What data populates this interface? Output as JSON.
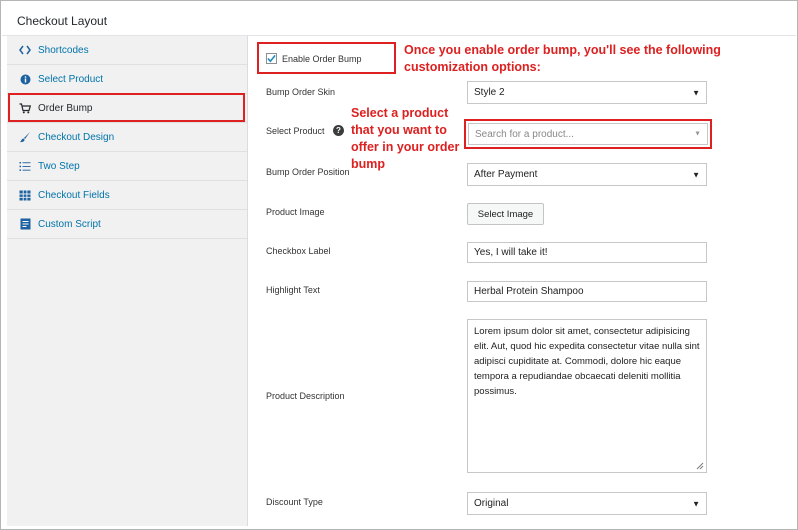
{
  "header": {
    "title": "Checkout Layout"
  },
  "sidebar": {
    "items": [
      {
        "label": "Shortcodes",
        "icon": "code-icon"
      },
      {
        "label": "Select Product",
        "icon": "info-icon"
      },
      {
        "label": "Order Bump",
        "icon": "cart-icon"
      },
      {
        "label": "Checkout Design",
        "icon": "brush-icon"
      },
      {
        "label": "Two Step",
        "icon": "list-icon"
      },
      {
        "label": "Checkout Fields",
        "icon": "table-icon"
      },
      {
        "label": "Custom Script",
        "icon": "document-icon"
      }
    ]
  },
  "form": {
    "enable_label": "Enable Order Bump",
    "enable_checked": true,
    "skin_label": "Bump Order Skin",
    "skin_value": "Style 2",
    "product_label": "Select Product",
    "product_placeholder": "Search for a product...",
    "position_label": "Bump Order Position",
    "position_value": "After Payment",
    "image_label": "Product Image",
    "image_button": "Select Image",
    "checkbox_label": "Checkbox Label",
    "checkbox_value": "Yes, I will take it!",
    "highlight_label": "Highlight Text",
    "highlight_value": "Herbal Protein Shampoo",
    "description_label": "Product Description",
    "description_value": "Lorem ipsum dolor sit amet, consectetur adipisicing elit. Aut, quod hic expedita consectetur vitae nulla sint adipisci cupiditate at. Commodi, dolore hic eaque tempora a repudiandae obcaecati deleniti mollitia possimus.",
    "discount_label": "Discount Type",
    "discount_value": "Original"
  },
  "callouts": {
    "top": "Once you enable order bump, you'll see the following customization options:",
    "product": "Select a product that you want to offer in your order bump"
  },
  "colors": {
    "highlight": "#dd2020",
    "link": "#0073aa"
  }
}
